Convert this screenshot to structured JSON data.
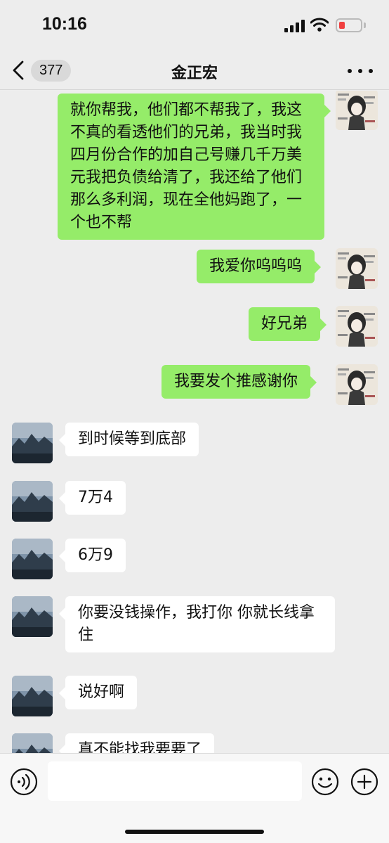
{
  "status_bar": {
    "time": "10:16"
  },
  "header": {
    "back_badge": "377",
    "title": "金正宏"
  },
  "messages": [
    {
      "sender": "me",
      "text": "就你帮我，他们都不帮我了，我这不真的看透他们的兄弟，我当时我四月份合作的加自己号赚几千万美元我把负债给清了，我还给了他们那么多利润，现在全他妈跑了，一个也不帮"
    },
    {
      "sender": "me",
      "text": "我爱你呜呜呜"
    },
    {
      "sender": "me",
      "text": "好兄弟"
    },
    {
      "sender": "me",
      "text": "我要发个推感谢你"
    },
    {
      "sender": "other",
      "text": "到时候等到底部"
    },
    {
      "sender": "other",
      "text": "7万4"
    },
    {
      "sender": "other",
      "text": "6万9"
    },
    {
      "sender": "other",
      "text": "你要没钱操作，我打你 你就长线拿住"
    },
    {
      "sender": "other",
      "text": "说好啊"
    },
    {
      "sender": "other",
      "text": "真不能找我要要了"
    }
  ],
  "input": {
    "value": ""
  },
  "colors": {
    "my_bubble": "#95ec69",
    "other_bubble": "#ffffff",
    "background": "#ededed",
    "battery_low": "#f04040"
  },
  "icons": {
    "back": "chevron-left-icon",
    "more": "more-dots-icon",
    "voice": "voice-icon",
    "emoji": "emoji-icon",
    "plus": "plus-icon"
  }
}
